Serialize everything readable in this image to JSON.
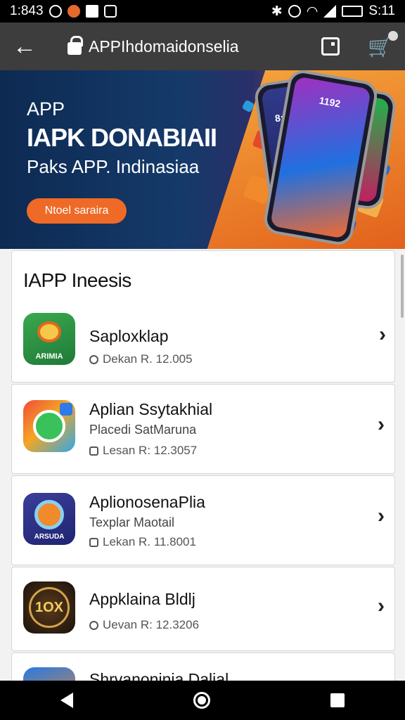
{
  "status_bar": {
    "time": "1:843",
    "right_text": "S:11",
    "icons": [
      "clock-icon",
      "app-icon",
      "image-icon",
      "shield-icon",
      "bluetooth-icon",
      "alarm-icon",
      "wifi-icon",
      "signal-icon",
      "battery-icon"
    ]
  },
  "app_bar": {
    "back_symbol": "←",
    "title": "APPIhdomaidonselia",
    "cart_symbol": "🛒"
  },
  "banner": {
    "kicker": "APP",
    "headline": "IAPK DONABIAII",
    "subtitle": "Paks APP. Indinasiaa",
    "cta_label": "Ntoel saraira",
    "phone_time_1": "8:38",
    "phone_time_2": "1192"
  },
  "section": {
    "title": "IAPP Ineesis"
  },
  "apps": [
    {
      "name": "Saploxklap",
      "subtitle": "",
      "meta": "Dekan R. 12.005",
      "icon_label": "ARIMIA",
      "icon_colors": [
        "#2e9a4a",
        "#1f7a38"
      ]
    },
    {
      "name": "Aplian Ssytakhial",
      "subtitle": "Placedi SatMaruna",
      "meta": "Lesan R: 12.3057",
      "icon_label": "",
      "icon_colors": [
        "#f04b3a",
        "#2ea8e8"
      ]
    },
    {
      "name": "AplionosenaPlia",
      "subtitle": "Texplar Maotail",
      "meta": "Lekan R. 11.8001",
      "icon_label": "ARSUDA",
      "icon_colors": [
        "#3a3f9a",
        "#1f2470"
      ]
    },
    {
      "name": "Appklaina Bldlj",
      "subtitle": "",
      "meta": "Uevan R: 12.3206",
      "icon_label": "1OX",
      "icon_colors": [
        "#2a1e14",
        "#5a3a1a"
      ]
    },
    {
      "name": "Shrvanoninia Dalial",
      "subtitle": "",
      "meta": "",
      "icon_label": "",
      "icon_colors": [
        "#2a7ae0",
        "#f08a2a"
      ]
    }
  ],
  "chevron": "›"
}
